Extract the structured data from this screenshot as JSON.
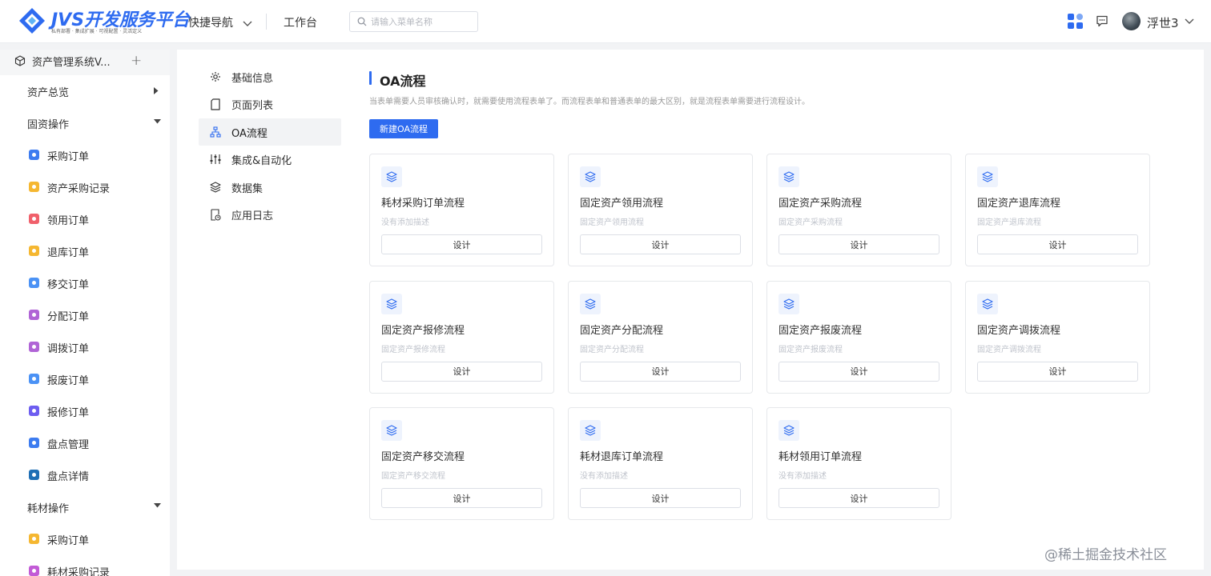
{
  "header": {
    "logo_title": "JVS开发服务平台",
    "logo_subtitle": "私有部署 · 集成扩展 · 可视配置 · 灵活定义",
    "quick_nav": "快捷导航",
    "workbench": "工作台",
    "search_placeholder": "请输入菜单名称",
    "username": "浮世3",
    "accent": "#2e6bf0"
  },
  "sidebar": {
    "app_name": "资产管理系统V...",
    "add_symbol": "+",
    "groups": [
      {
        "label": "资产总览",
        "expanded": false,
        "items": []
      },
      {
        "label": "固资操作",
        "expanded": true,
        "items": [
          {
            "label": "采购订单",
            "color": "#3d7cf0"
          },
          {
            "label": "资产采购记录",
            "color": "#f5b731"
          },
          {
            "label": "领用订单",
            "color": "#f0606b"
          },
          {
            "label": "退库订单",
            "color": "#f5b731"
          },
          {
            "label": "移交订单",
            "color": "#4b92f5"
          },
          {
            "label": "分配订单",
            "color": "#b064d6"
          },
          {
            "label": "调拨订单",
            "color": "#b064d6"
          },
          {
            "label": "报废订单",
            "color": "#4b92f5"
          },
          {
            "label": "报修订单",
            "color": "#6d5df0"
          },
          {
            "label": "盘点管理",
            "color": "#3d7cf0"
          },
          {
            "label": "盘点详情",
            "color": "#1f6fb5"
          }
        ]
      },
      {
        "label": "耗材操作",
        "expanded": true,
        "items": [
          {
            "label": "采购订单",
            "color": "#f5b731"
          },
          {
            "label": "耗材采购记录",
            "color": "#c25bd6"
          }
        ]
      }
    ]
  },
  "subnav": [
    {
      "label": "基础信息",
      "icon": "gear-icon",
      "active": false
    },
    {
      "label": "页面列表",
      "icon": "page-icon",
      "active": false
    },
    {
      "label": "OA流程",
      "icon": "flow-icon",
      "active": true
    },
    {
      "label": "集成&自动化",
      "icon": "sliders-icon",
      "active": false
    },
    {
      "label": "数据集",
      "icon": "layers-icon",
      "active": false
    },
    {
      "label": "应用日志",
      "icon": "log-icon",
      "active": false
    }
  ],
  "content": {
    "title": "OA流程",
    "description": "当表单需要人员审核确认时，就需要使用流程表单了。而流程表单和普通表单的最大区别，就是流程表单需要进行流程设计。",
    "new_button": "新建OA流程",
    "cards": [
      {
        "title": "耗材采购订单流程",
        "desc": "没有添加描述",
        "button": "设计"
      },
      {
        "title": "固定资产领用流程",
        "desc": "固定资产领用流程",
        "button": "设计"
      },
      {
        "title": "固定资产采购流程",
        "desc": "固定资产采购流程",
        "button": "设计"
      },
      {
        "title": "固定资产退库流程",
        "desc": "固定资产退库流程",
        "button": "设计"
      },
      {
        "title": "固定资产报修流程",
        "desc": "固定资产报修流程",
        "button": "设计"
      },
      {
        "title": "固定资产分配流程",
        "desc": "固定资产分配流程",
        "button": "设计"
      },
      {
        "title": "固定资产报废流程",
        "desc": "固定资产报废流程",
        "button": "设计"
      },
      {
        "title": "固定资产调拨流程",
        "desc": "固定资产调拨流程",
        "button": "设计"
      },
      {
        "title": "固定资产移交流程",
        "desc": "固定资产移交流程",
        "button": "设计"
      },
      {
        "title": "耗材退库订单流程",
        "desc": "没有添加描述",
        "button": "设计"
      },
      {
        "title": "耗材领用订单流程",
        "desc": "没有添加描述",
        "button": "设计"
      }
    ]
  },
  "watermark": "@稀土掘金技术社区"
}
